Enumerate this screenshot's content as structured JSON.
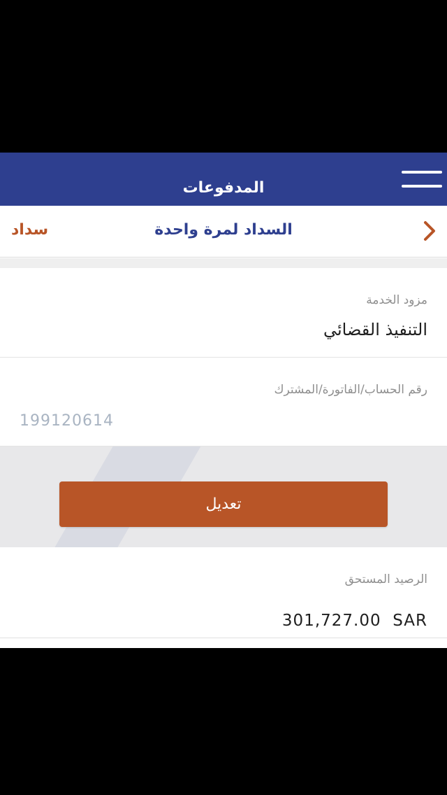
{
  "header": {
    "title": "المدفوعات",
    "menu_icon": "hamburger-menu-icon"
  },
  "subheader": {
    "title": "السداد لمرة واحدة",
    "back_label": "سداد",
    "chevron_icon": "chevron-right-icon"
  },
  "form": {
    "provider": {
      "label": "مزود الخدمة",
      "value": "التنفيذ القضائي"
    },
    "account": {
      "label": "رقم الحساب/الفاتورة/المشترك",
      "value": "199120614"
    }
  },
  "actions": {
    "edit_label": "تعديل"
  },
  "balance": {
    "label": "الرصيد المستحق",
    "amount": "301,727.00",
    "currency": "SAR"
  },
  "colors": {
    "primary": "#2e3f8f",
    "accent": "#b85527"
  }
}
